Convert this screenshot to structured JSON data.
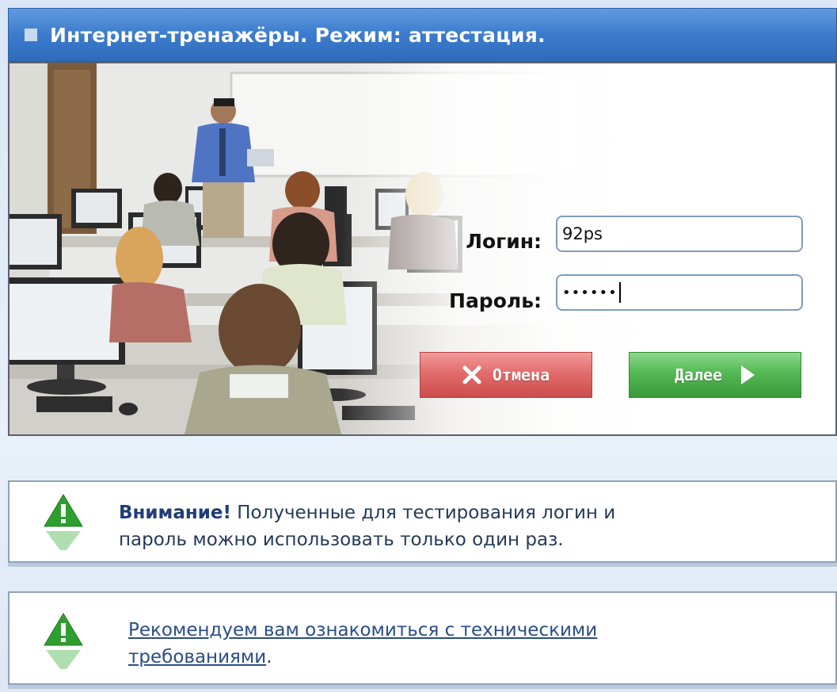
{
  "header": {
    "title": "Интернет-тренажёры. Режим: аттестация."
  },
  "login": {
    "login_label": "Логин:",
    "login_value": "92ps",
    "password_label": "Пароль:",
    "password_value": "••••••"
  },
  "buttons": {
    "cancel_label": "Отмена",
    "next_label": "Далее"
  },
  "notices": {
    "warning_bold": "Внимание!",
    "warning_line1": " Полученные для тестирования логин и",
    "warning_line2": "пароль можно использовать только один раз.",
    "recommend_link_line1": "Рекомендуем вам ознакомиться с техническими",
    "recommend_link_line2": "требованиями",
    "recommend_tail": "."
  },
  "colors": {
    "header": "#3d7ccd",
    "cancel": "#d9534f",
    "next": "#46a946",
    "warning_icon": "#2e9e2e"
  },
  "icons": [
    "square-icon",
    "close-x-icon",
    "play-arrow-icon",
    "warning-triangle-icon"
  ]
}
